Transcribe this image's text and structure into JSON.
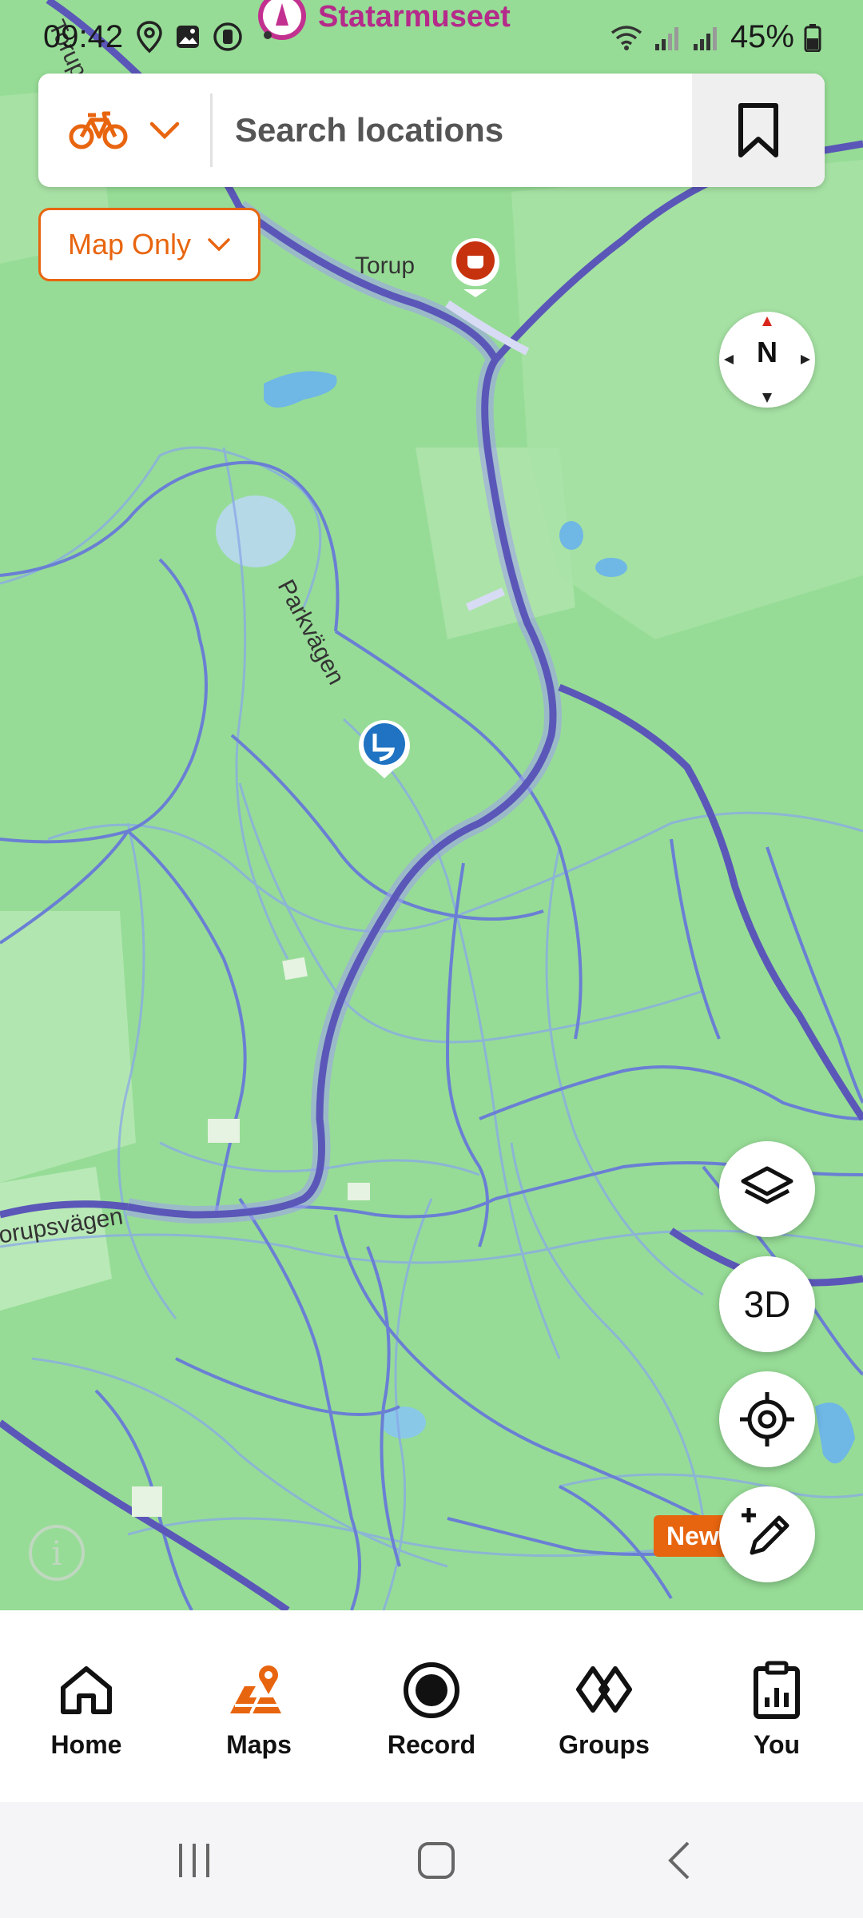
{
  "status": {
    "time": "09:42",
    "battery": "45%"
  },
  "poi_top": {
    "label": "Statarmuseet"
  },
  "search": {
    "placeholder": "Search locations"
  },
  "map_filter": {
    "label": "Map Only"
  },
  "compass": {
    "label": "N"
  },
  "map_labels": {
    "torup": "Torup",
    "parkvagen": "Parkvägen",
    "torupsvagen": "orupsvägen",
    "torup_edge": "Torup"
  },
  "fabs": {
    "three_d": "3D",
    "new_badge": "New"
  },
  "tabs": [
    {
      "label": "Home"
    },
    {
      "label": "Maps"
    },
    {
      "label": "Record"
    },
    {
      "label": "Groups"
    },
    {
      "label": "You"
    }
  ],
  "colors": {
    "accent": "#e8650f",
    "map_bg": "#96dc96",
    "road": "#5b57b8",
    "poi_pink": "#b52a8a"
  },
  "icons": {
    "sport": "bike-icon",
    "save": "bookmark-icon",
    "layers": "layers-icon",
    "locate": "crosshair-icon",
    "create_route": "route-pencil-icon"
  }
}
